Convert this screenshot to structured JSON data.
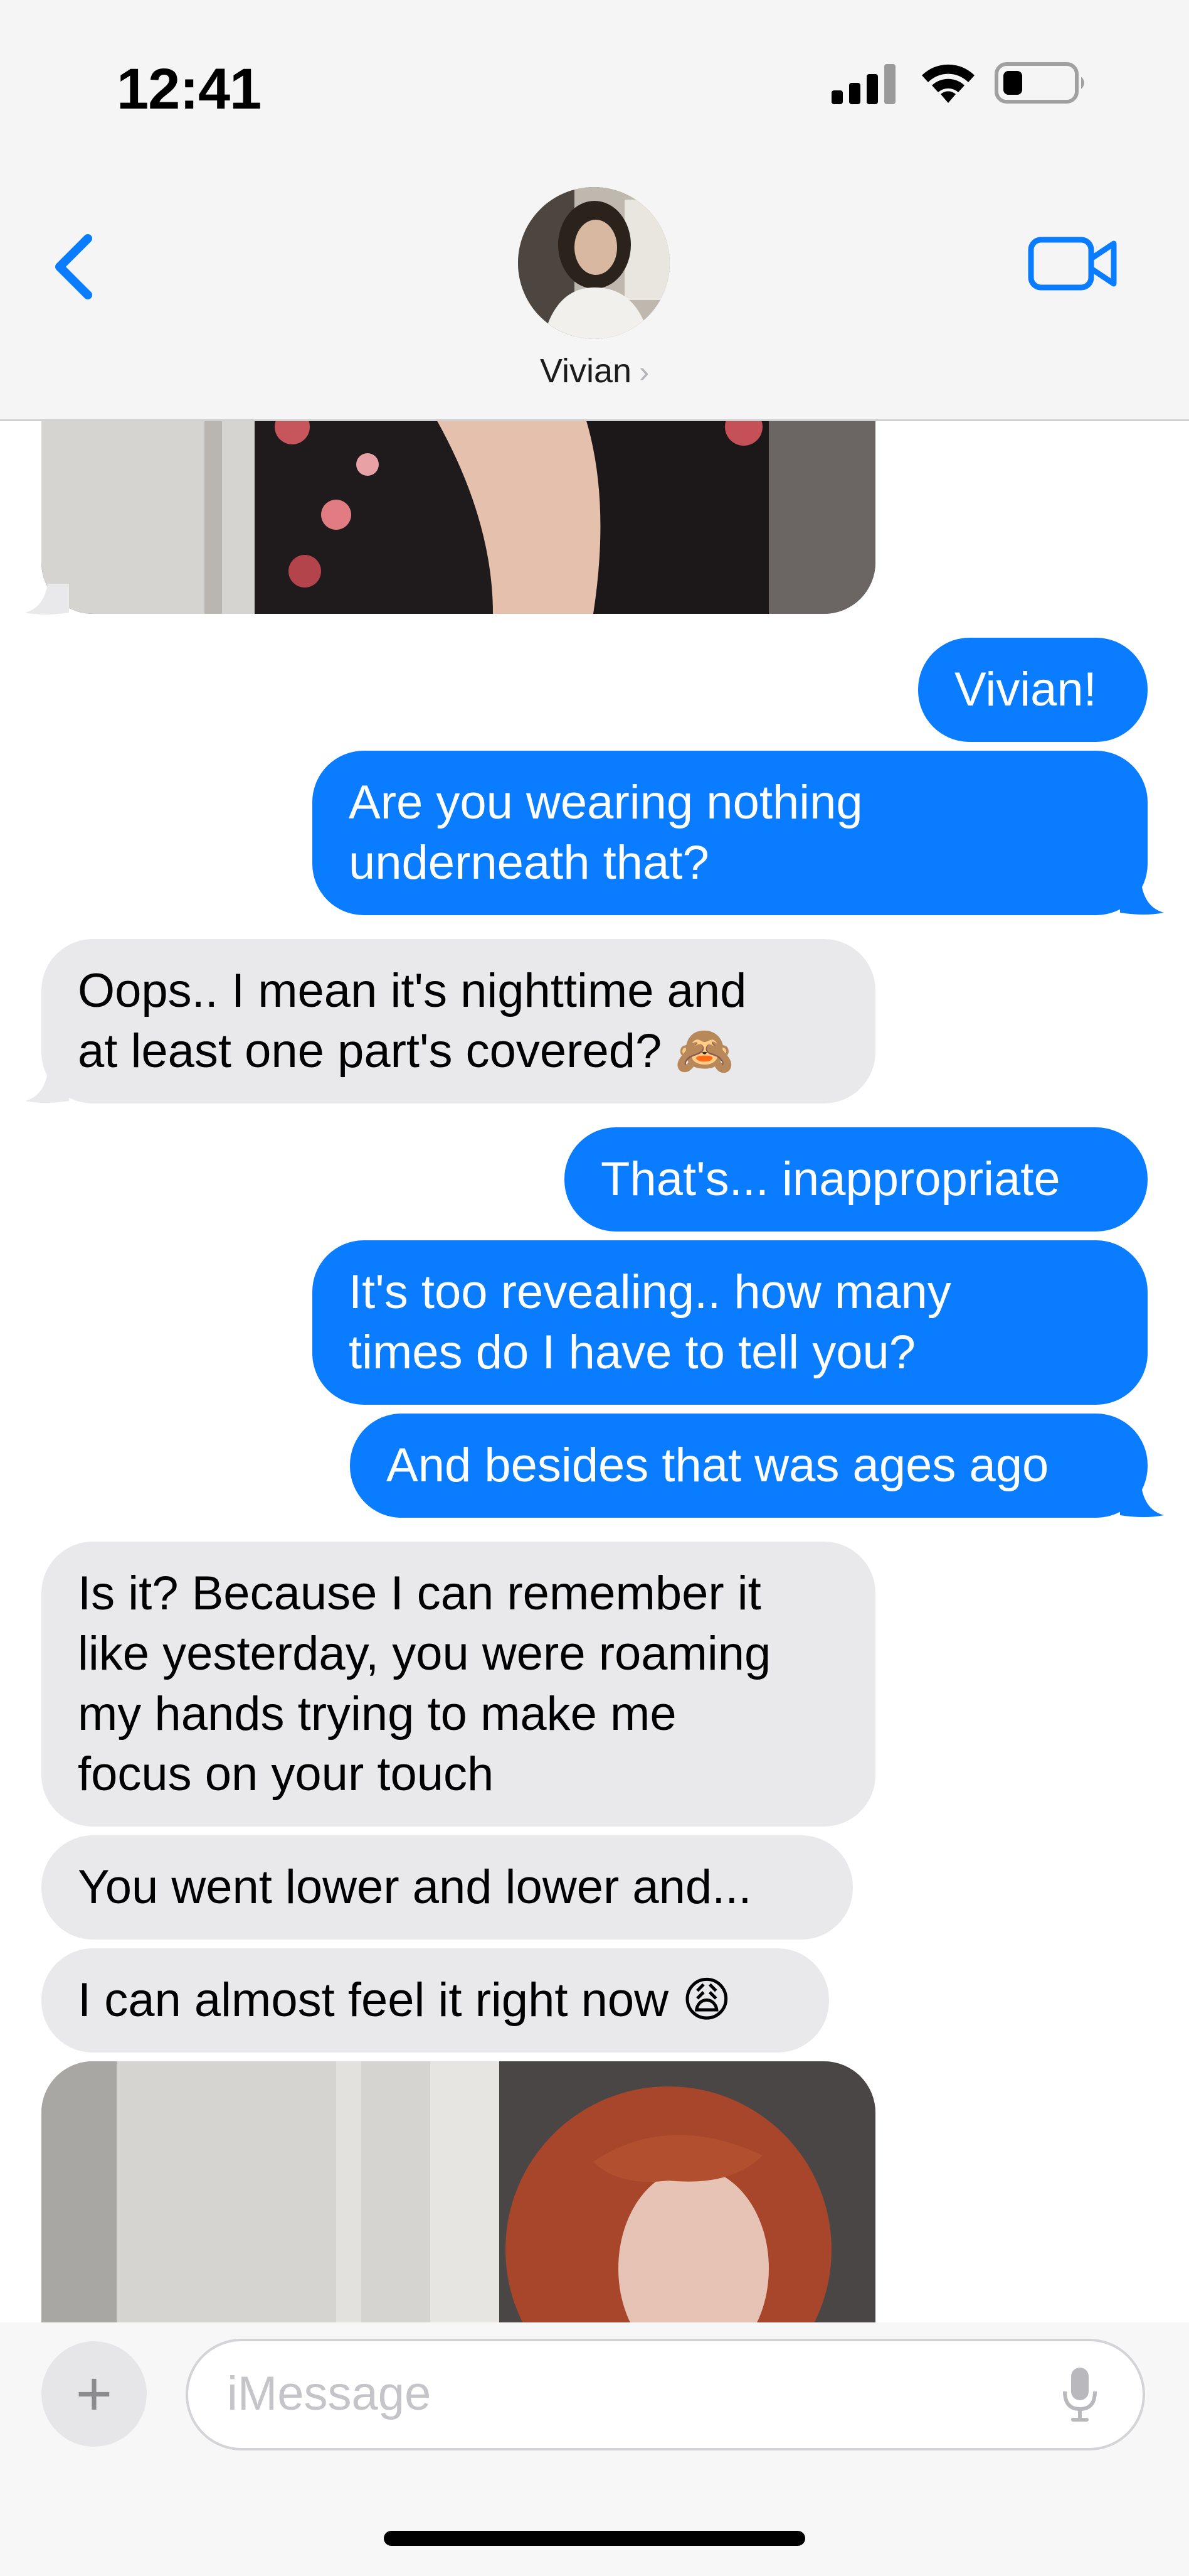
{
  "status_bar": {
    "time": "12:41"
  },
  "header": {
    "contact_name": "Vivian",
    "chevron": "›",
    "back_icon": "chevron-left-icon",
    "video_icon": "video-camera-icon"
  },
  "messages": [
    {
      "direction": "in",
      "kind": "photo"
    },
    {
      "direction": "out",
      "lines": [
        "Vivian!"
      ]
    },
    {
      "direction": "out",
      "lines": [
        "Are you wearing nothing",
        "underneath that?"
      ]
    },
    {
      "direction": "in",
      "lines": [
        "Oops.. I mean it's nighttime and",
        "at least one part's covered? 🙈"
      ]
    },
    {
      "direction": "out",
      "lines": [
        "That's... inappropriate"
      ]
    },
    {
      "direction": "out",
      "lines": [
        "It's too revealing.. how many",
        "times do I have to tell you?"
      ]
    },
    {
      "direction": "out",
      "lines": [
        "And besides that was ages ago"
      ]
    },
    {
      "direction": "in",
      "lines": [
        "Is it? Because I can remember it",
        "like yesterday, you were roaming",
        "my hands trying to make me",
        "focus on your touch"
      ]
    },
    {
      "direction": "in",
      "lines": [
        "You went lower and lower and..."
      ]
    },
    {
      "direction": "in",
      "lines": [
        "I can almost feel it right now 😩"
      ]
    },
    {
      "direction": "in",
      "kind": "photo"
    }
  ],
  "composer": {
    "plus_label": "+",
    "placeholder": "iMessage",
    "mic_icon": "microphone-icon"
  },
  "colors": {
    "outgoing_bubble": "#0a7cff",
    "incoming_bubble": "#e9e9eb",
    "accent": "#0a7cff"
  }
}
